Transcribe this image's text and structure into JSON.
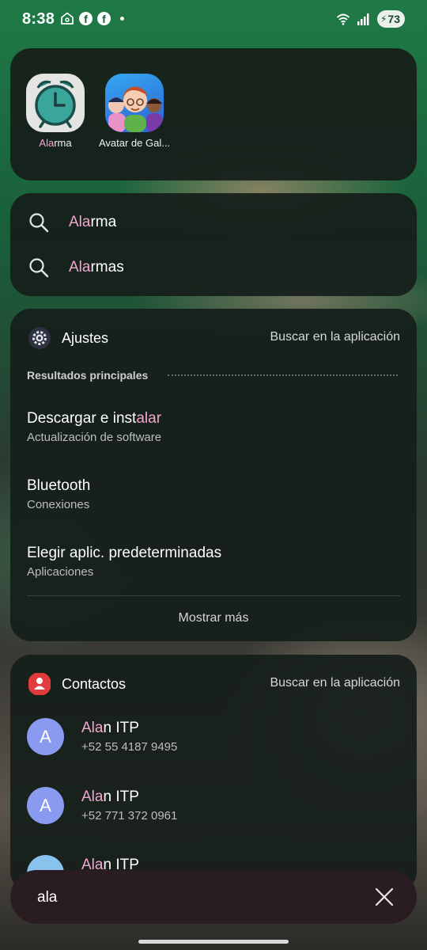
{
  "status_bar": {
    "time": "8:38",
    "battery": "73",
    "icons": [
      "home-icon",
      "facebook-icon",
      "facebook-icon",
      "notification-dot",
      "wifi-icon",
      "signal-icon",
      "battery-icon"
    ]
  },
  "apps": [
    {
      "label_hl": "Ala",
      "label_rest": "rma",
      "icon": "alarm-clock-icon"
    },
    {
      "label_hl": "",
      "label_rest": "Avatar de Gal...",
      "icon": "avatar-app-icon"
    }
  ],
  "suggestions": [
    {
      "hl": "Ala",
      "rest": "rma"
    },
    {
      "hl": "Ala",
      "rest": "rmas"
    }
  ],
  "settings_card": {
    "title": "Ajustes",
    "search_in_app": "Buscar en la aplicación",
    "section_label": "Resultados principales",
    "results": [
      {
        "title_pre": "Descargar e inst",
        "title_hl": "alar",
        "title_post": "",
        "subtitle": "Actualización de software"
      },
      {
        "title_pre": "Bluetooth",
        "title_hl": "",
        "title_post": "",
        "subtitle": "Conexiones"
      },
      {
        "title_pre": "Elegir aplic. predeterminadas",
        "title_hl": "",
        "title_post": "",
        "subtitle": "Aplicaciones"
      }
    ],
    "show_more": "Mostrar más"
  },
  "contacts_card": {
    "title": "Contactos",
    "search_in_app": "Buscar en la aplicación",
    "contacts": [
      {
        "initial": "A",
        "name_hl": "Ala",
        "name_rest": "n ITP",
        "phone": "+52 55 4187 9495"
      },
      {
        "initial": "A",
        "name_hl": "Ala",
        "name_rest": "n ITP",
        "phone": "+52 771 372 0961"
      },
      {
        "initial": "",
        "name_hl": "Ala",
        "name_rest": "n ITP",
        "phone": ""
      }
    ]
  },
  "search": {
    "query": "ala"
  },
  "colors": {
    "highlight": "#f4a6d1",
    "card_bg": "#161e1a",
    "search_bg": "#2a1d21"
  }
}
